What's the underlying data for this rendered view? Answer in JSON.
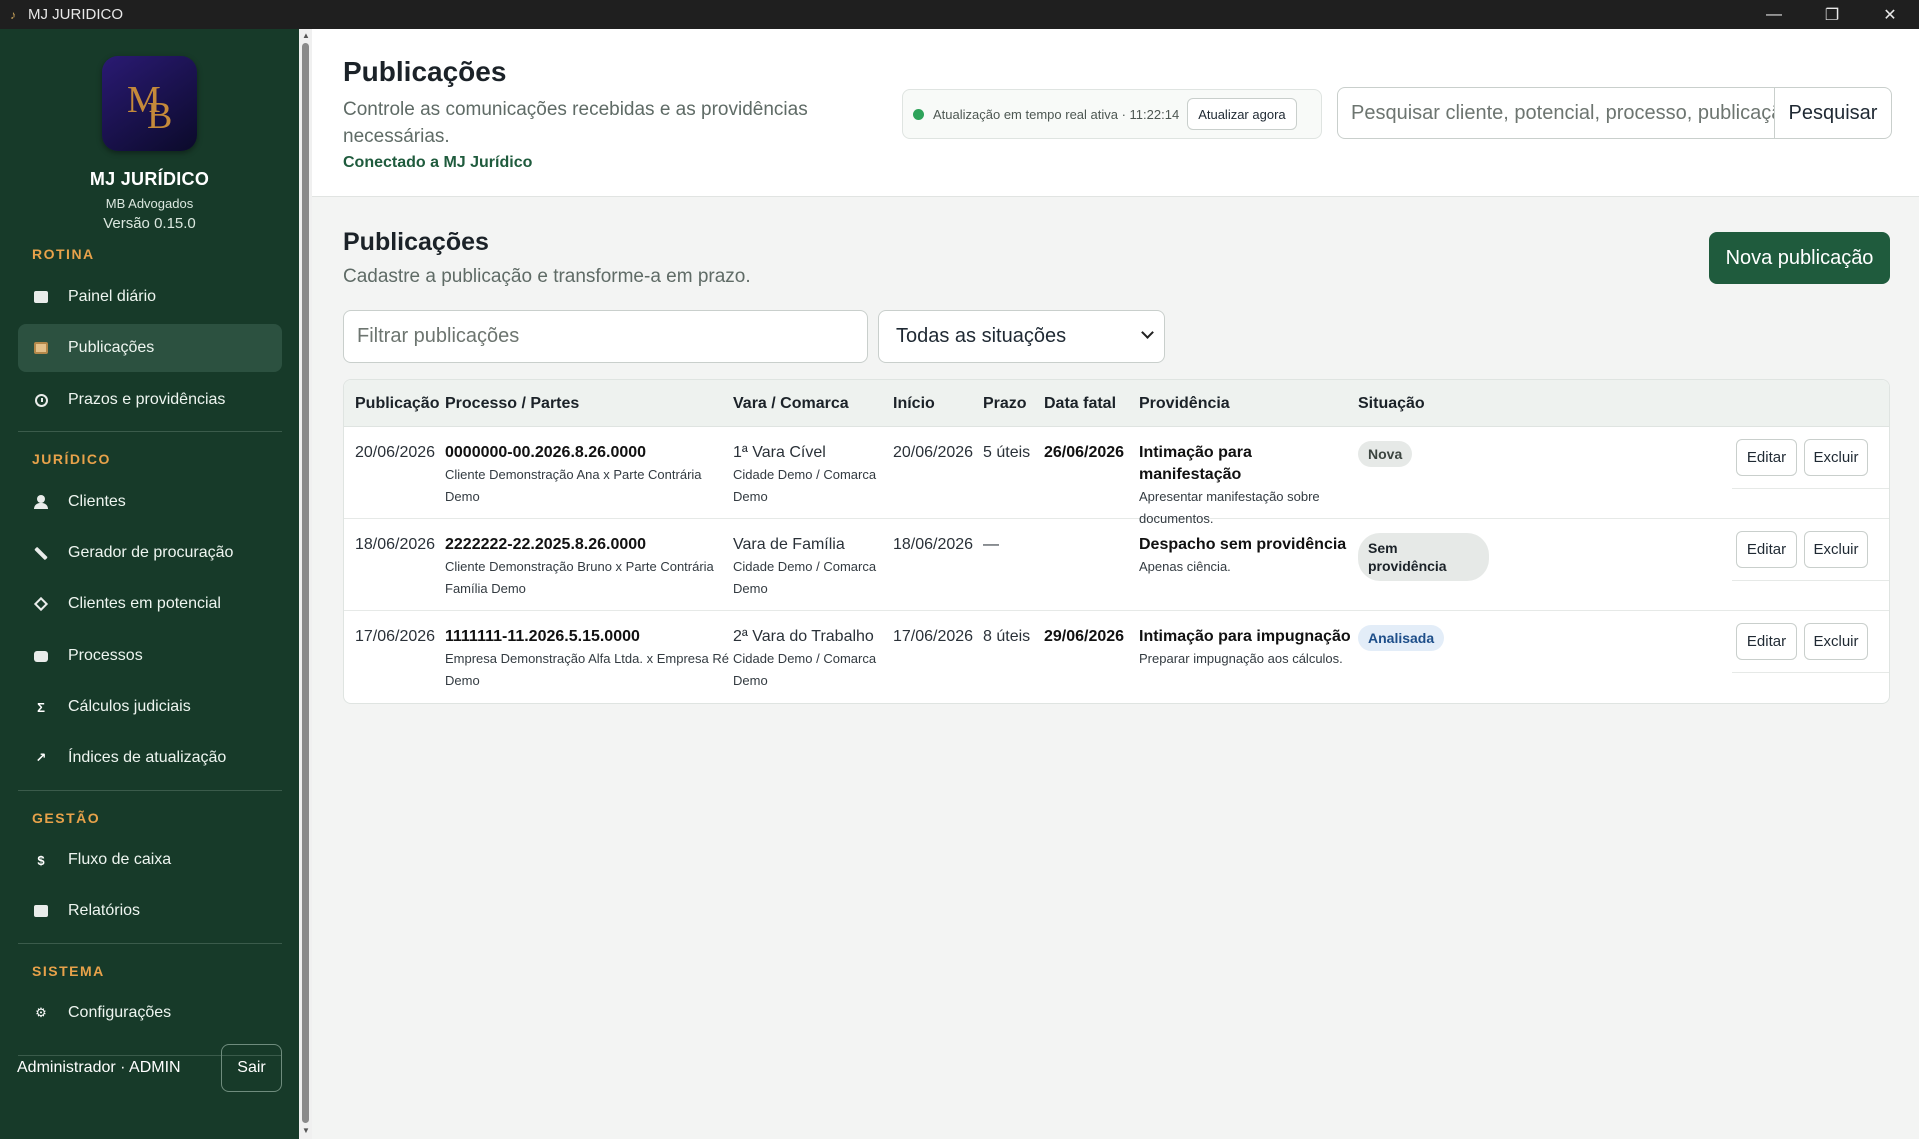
{
  "window": {
    "title": "MJ JURIDICO",
    "minimize": "—",
    "maximize": "❐",
    "close": "✕"
  },
  "sidebar": {
    "brand": {
      "name": "MJ JURÍDICO",
      "office": "MB Advogados",
      "version": "Versão 0.15.0"
    },
    "sections": {
      "rotina": "ROTINA",
      "juridico": "JURÍDICO",
      "gestao": "GESTÃO",
      "sistema": "SISTEMA"
    },
    "items": {
      "painel": "Painel diário",
      "publicacoes": "Publicações",
      "prazos": "Prazos e providências",
      "clientes": "Clientes",
      "procuracao": "Gerador de procuração",
      "potencial": "Clientes em potencial",
      "processos": "Processos",
      "calculos": "Cálculos judiciais",
      "indices": "Índices de atualização",
      "fluxo": "Fluxo de caixa",
      "relatorios": "Relatórios",
      "config": "Configurações"
    },
    "icons": {
      "calculos": "Σ",
      "indices": "↗",
      "fluxo": "$",
      "config": "⚙"
    },
    "user": "Administrador · ADMIN",
    "logout": "Sair"
  },
  "header": {
    "title": "Publicações",
    "subtitle": "Controle as comunicações recebidas e as providências necessárias.",
    "connected": "Conectado a MJ Jurídico",
    "realtime_text": "Atualização em tempo real ativa · 11:22:14",
    "refresh_label": "Atualizar agora",
    "search_placeholder": "Pesquisar cliente, potencial, processo, publicação",
    "search_button": "Pesquisar"
  },
  "main": {
    "title": "Publicações",
    "subtitle": "Cadastre a publicação e transforme-a em prazo.",
    "new_button": "Nova publicação",
    "filter_placeholder": "Filtrar publicações",
    "status_filter": "Todas as situações"
  },
  "table": {
    "headers": {
      "publicacao": "Publicação",
      "processo": "Processo / Partes",
      "vara": "Vara / Comarca",
      "inicio": "Início",
      "prazo": "Prazo",
      "data_fatal": "Data fatal",
      "providencia": "Providência",
      "situacao": "Situação"
    },
    "rows": [
      {
        "publicacao": "20/06/2026",
        "processo": "0000000-00.2026.8.26.0000",
        "partes": "Cliente Demonstração Ana x Parte Contrária Demo",
        "vara": "1ª Vara Cível",
        "comarca": "Cidade Demo / Comarca Demo",
        "inicio": "20/06/2026",
        "prazo": "5 úteis",
        "data_fatal": "26/06/2026",
        "providencia": "Intimação para manifestação",
        "providencia_desc": "Apresentar manifestação sobre documentos.",
        "situacao": "Nova",
        "edit": "Editar",
        "delete": "Excluir"
      },
      {
        "publicacao": "18/06/2026",
        "processo": "2222222-22.2025.8.26.0000",
        "partes": "Cliente Demonstração Bruno x Parte Contrária Família Demo",
        "vara": "Vara de Família",
        "comarca": "Cidade Demo / Comarca Demo",
        "inicio": "18/06/2026",
        "prazo": "—",
        "data_fatal": "",
        "providencia": "Despacho sem providência",
        "providencia_desc": "Apenas ciência.",
        "situacao": "Sem providência",
        "edit": "Editar",
        "delete": "Excluir"
      },
      {
        "publicacao": "17/06/2026",
        "processo": "1111111-11.2026.5.15.0000",
        "partes": "Empresa Demonstração Alfa Ltda. x Empresa Ré Demo",
        "vara": "2ª Vara do Trabalho",
        "comarca": "Cidade Demo / Comarca Demo",
        "inicio": "17/06/2026",
        "prazo": "8 úteis",
        "data_fatal": "29/06/2026",
        "providencia": "Intimação para impugnação",
        "providencia_desc": "Preparar impugnação aos cálculos.",
        "situacao": "Analisada",
        "edit": "Editar",
        "delete": "Excluir"
      }
    ]
  },
  "colors": {
    "sidebar_bg": "#173a29",
    "accent_green": "#1f5b3d",
    "section_orange": "#e8a24a",
    "status_green": "#2ea35a"
  }
}
